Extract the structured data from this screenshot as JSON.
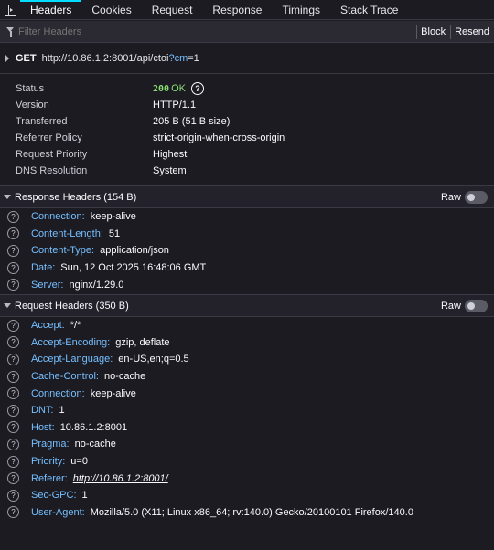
{
  "tabs": [
    {
      "label": "Headers"
    },
    {
      "label": "Cookies"
    },
    {
      "label": "Request"
    },
    {
      "label": "Response"
    },
    {
      "label": "Timings"
    },
    {
      "label": "Stack Trace"
    }
  ],
  "filter": {
    "placeholder": "Filter Headers",
    "block_label": "Block",
    "resend_label": "Resend"
  },
  "request_line": {
    "method": "GET",
    "url_base": "http://10.86.1.2:8001/api/ctoi",
    "url_q": "?cm",
    "url_rest": "=1"
  },
  "summary": {
    "status_key": "Status",
    "status_code": "200",
    "status_text": "OK",
    "version_key": "Version",
    "version_val": "HTTP/1.1",
    "transferred_key": "Transferred",
    "transferred_val": "205 B (51 B size)",
    "referrer_key": "Referrer Policy",
    "referrer_val": "strict-origin-when-cross-origin",
    "priority_key": "Request Priority",
    "priority_val": "Highest",
    "dns_key": "DNS Resolution",
    "dns_val": "System"
  },
  "response_section": {
    "title": "Response Headers (154 B)",
    "raw_label": "Raw"
  },
  "response_headers": [
    {
      "name": "Connection:",
      "value": "keep-alive"
    },
    {
      "name": "Content-Length:",
      "value": "51"
    },
    {
      "name": "Content-Type:",
      "value": "application/json"
    },
    {
      "name": "Date:",
      "value": "Sun, 12 Oct 2025 16:48:06 GMT"
    },
    {
      "name": "Server:",
      "value": "nginx/1.29.0"
    }
  ],
  "request_section": {
    "title": "Request Headers (350 B)",
    "raw_label": "Raw"
  },
  "request_headers": [
    {
      "name": "Accept:",
      "value": "*/*"
    },
    {
      "name": "Accept-Encoding:",
      "value": "gzip, deflate"
    },
    {
      "name": "Accept-Language:",
      "value": "en-US,en;q=0.5"
    },
    {
      "name": "Cache-Control:",
      "value": "no-cache"
    },
    {
      "name": "Connection:",
      "value": "keep-alive"
    },
    {
      "name": "DNT:",
      "value": "1"
    },
    {
      "name": "Host:",
      "value": "10.86.1.2:8001"
    },
    {
      "name": "Pragma:",
      "value": "no-cache"
    },
    {
      "name": "Priority:",
      "value": "u=0"
    },
    {
      "name": "Referer:",
      "value": "http://10.86.1.2:8001/"
    },
    {
      "name": "Sec-GPC:",
      "value": "1"
    },
    {
      "name": "User-Agent:",
      "value": "Mozilla/5.0 (X11; Linux x86_64; rv:140.0) Gecko/20100101 Firefox/140.0"
    }
  ],
  "help_glyph": "?",
  "colors": {
    "accent": "#00ddff",
    "status_ok": "#86de74",
    "header_name": "#75bfff"
  }
}
